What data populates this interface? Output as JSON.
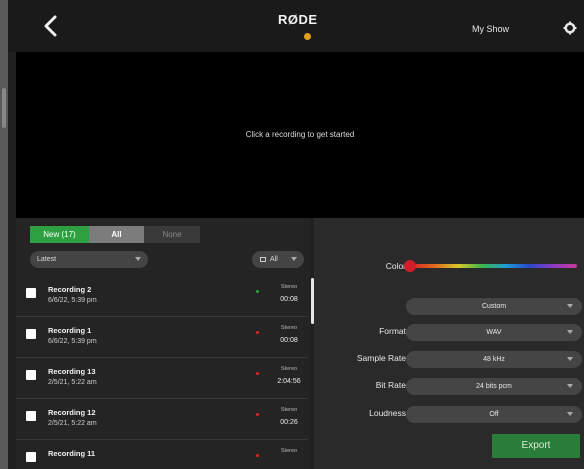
{
  "header": {
    "logo_text": "RØDE",
    "show_name": "My Show",
    "accent_color": "#e2a01f"
  },
  "player": {
    "message": "Click a recording to get started"
  },
  "filters": {
    "new_label": "New (17)",
    "all_label": "All",
    "none_label": "None",
    "active": "All"
  },
  "sort": {
    "value": "Latest"
  },
  "type_filter": {
    "value": "All"
  },
  "recordings": [
    {
      "name": "Recording 2",
      "date": "6/6/22, 5:39 pm",
      "channels": "Stereo",
      "duration": "00:08",
      "dot_color": "#2fa041"
    },
    {
      "name": "Recording 1",
      "date": "6/6/22, 5:39 pm",
      "channels": "Stereo",
      "duration": "00:08",
      "dot_color": "#d62828"
    },
    {
      "name": "Recording 13",
      "date": "2/5/21, 5:22 am",
      "channels": "Stereo",
      "duration": "2:04:56",
      "dot_color": "#d62828"
    },
    {
      "name": "Recording 12",
      "date": "2/5/21, 5:22 am",
      "channels": "Stereo",
      "duration": "00:26",
      "dot_color": "#d62828"
    },
    {
      "name": "Recording 11",
      "date": "",
      "channels": "Stereo",
      "duration": "",
      "dot_color": "#d62828"
    }
  ],
  "settings": {
    "color_label": "Color",
    "preset_value": "Custom",
    "format_label": "Format",
    "format_value": "WAV",
    "sample_rate_label": "Sample Rate",
    "sample_rate_value": "48 kHz",
    "bit_rate_label": "Bit Rate",
    "bit_rate_value": "24 bits pcm",
    "loudness_label": "Loudness",
    "loudness_value": "Off",
    "export_label": "Export"
  }
}
